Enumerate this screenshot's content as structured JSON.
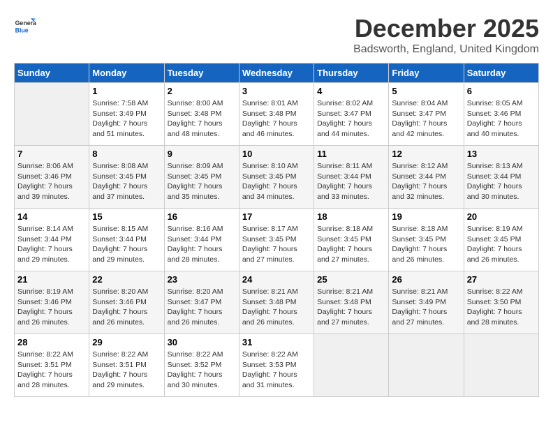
{
  "header": {
    "logo_general": "General",
    "logo_blue": "Blue",
    "month_title": "December 2025",
    "location": "Badsworth, England, United Kingdom"
  },
  "calendar": {
    "weekdays": [
      "Sunday",
      "Monday",
      "Tuesday",
      "Wednesday",
      "Thursday",
      "Friday",
      "Saturday"
    ],
    "weeks": [
      [
        {
          "day": "",
          "empty": true
        },
        {
          "day": "1",
          "sunrise": "7:58 AM",
          "sunset": "3:49 PM",
          "daylight": "7 hours and 51 minutes."
        },
        {
          "day": "2",
          "sunrise": "8:00 AM",
          "sunset": "3:48 PM",
          "daylight": "7 hours and 48 minutes."
        },
        {
          "day": "3",
          "sunrise": "8:01 AM",
          "sunset": "3:48 PM",
          "daylight": "7 hours and 46 minutes."
        },
        {
          "day": "4",
          "sunrise": "8:02 AM",
          "sunset": "3:47 PM",
          "daylight": "7 hours and 44 minutes."
        },
        {
          "day": "5",
          "sunrise": "8:04 AM",
          "sunset": "3:47 PM",
          "daylight": "7 hours and 42 minutes."
        },
        {
          "day": "6",
          "sunrise": "8:05 AM",
          "sunset": "3:46 PM",
          "daylight": "7 hours and 40 minutes."
        }
      ],
      [
        {
          "day": "7",
          "sunrise": "8:06 AM",
          "sunset": "3:46 PM",
          "daylight": "7 hours and 39 minutes."
        },
        {
          "day": "8",
          "sunrise": "8:08 AM",
          "sunset": "3:45 PM",
          "daylight": "7 hours and 37 minutes."
        },
        {
          "day": "9",
          "sunrise": "8:09 AM",
          "sunset": "3:45 PM",
          "daylight": "7 hours and 35 minutes."
        },
        {
          "day": "10",
          "sunrise": "8:10 AM",
          "sunset": "3:45 PM",
          "daylight": "7 hours and 34 minutes."
        },
        {
          "day": "11",
          "sunrise": "8:11 AM",
          "sunset": "3:44 PM",
          "daylight": "7 hours and 33 minutes."
        },
        {
          "day": "12",
          "sunrise": "8:12 AM",
          "sunset": "3:44 PM",
          "daylight": "7 hours and 32 minutes."
        },
        {
          "day": "13",
          "sunrise": "8:13 AM",
          "sunset": "3:44 PM",
          "daylight": "7 hours and 30 minutes."
        }
      ],
      [
        {
          "day": "14",
          "sunrise": "8:14 AM",
          "sunset": "3:44 PM",
          "daylight": "7 hours and 29 minutes."
        },
        {
          "day": "15",
          "sunrise": "8:15 AM",
          "sunset": "3:44 PM",
          "daylight": "7 hours and 29 minutes."
        },
        {
          "day": "16",
          "sunrise": "8:16 AM",
          "sunset": "3:44 PM",
          "daylight": "7 hours and 28 minutes."
        },
        {
          "day": "17",
          "sunrise": "8:17 AM",
          "sunset": "3:45 PM",
          "daylight": "7 hours and 27 minutes."
        },
        {
          "day": "18",
          "sunrise": "8:18 AM",
          "sunset": "3:45 PM",
          "daylight": "7 hours and 27 minutes."
        },
        {
          "day": "19",
          "sunrise": "8:18 AM",
          "sunset": "3:45 PM",
          "daylight": "7 hours and 26 minutes."
        },
        {
          "day": "20",
          "sunrise": "8:19 AM",
          "sunset": "3:45 PM",
          "daylight": "7 hours and 26 minutes."
        }
      ],
      [
        {
          "day": "21",
          "sunrise": "8:19 AM",
          "sunset": "3:46 PM",
          "daylight": "7 hours and 26 minutes."
        },
        {
          "day": "22",
          "sunrise": "8:20 AM",
          "sunset": "3:46 PM",
          "daylight": "7 hours and 26 minutes."
        },
        {
          "day": "23",
          "sunrise": "8:20 AM",
          "sunset": "3:47 PM",
          "daylight": "7 hours and 26 minutes."
        },
        {
          "day": "24",
          "sunrise": "8:21 AM",
          "sunset": "3:48 PM",
          "daylight": "7 hours and 26 minutes."
        },
        {
          "day": "25",
          "sunrise": "8:21 AM",
          "sunset": "3:48 PM",
          "daylight": "7 hours and 27 minutes."
        },
        {
          "day": "26",
          "sunrise": "8:21 AM",
          "sunset": "3:49 PM",
          "daylight": "7 hours and 27 minutes."
        },
        {
          "day": "27",
          "sunrise": "8:22 AM",
          "sunset": "3:50 PM",
          "daylight": "7 hours and 28 minutes."
        }
      ],
      [
        {
          "day": "28",
          "sunrise": "8:22 AM",
          "sunset": "3:51 PM",
          "daylight": "7 hours and 28 minutes."
        },
        {
          "day": "29",
          "sunrise": "8:22 AM",
          "sunset": "3:51 PM",
          "daylight": "7 hours and 29 minutes."
        },
        {
          "day": "30",
          "sunrise": "8:22 AM",
          "sunset": "3:52 PM",
          "daylight": "7 hours and 30 minutes."
        },
        {
          "day": "31",
          "sunrise": "8:22 AM",
          "sunset": "3:53 PM",
          "daylight": "7 hours and 31 minutes."
        },
        {
          "day": "",
          "empty": true
        },
        {
          "day": "",
          "empty": true
        },
        {
          "day": "",
          "empty": true
        }
      ]
    ]
  }
}
